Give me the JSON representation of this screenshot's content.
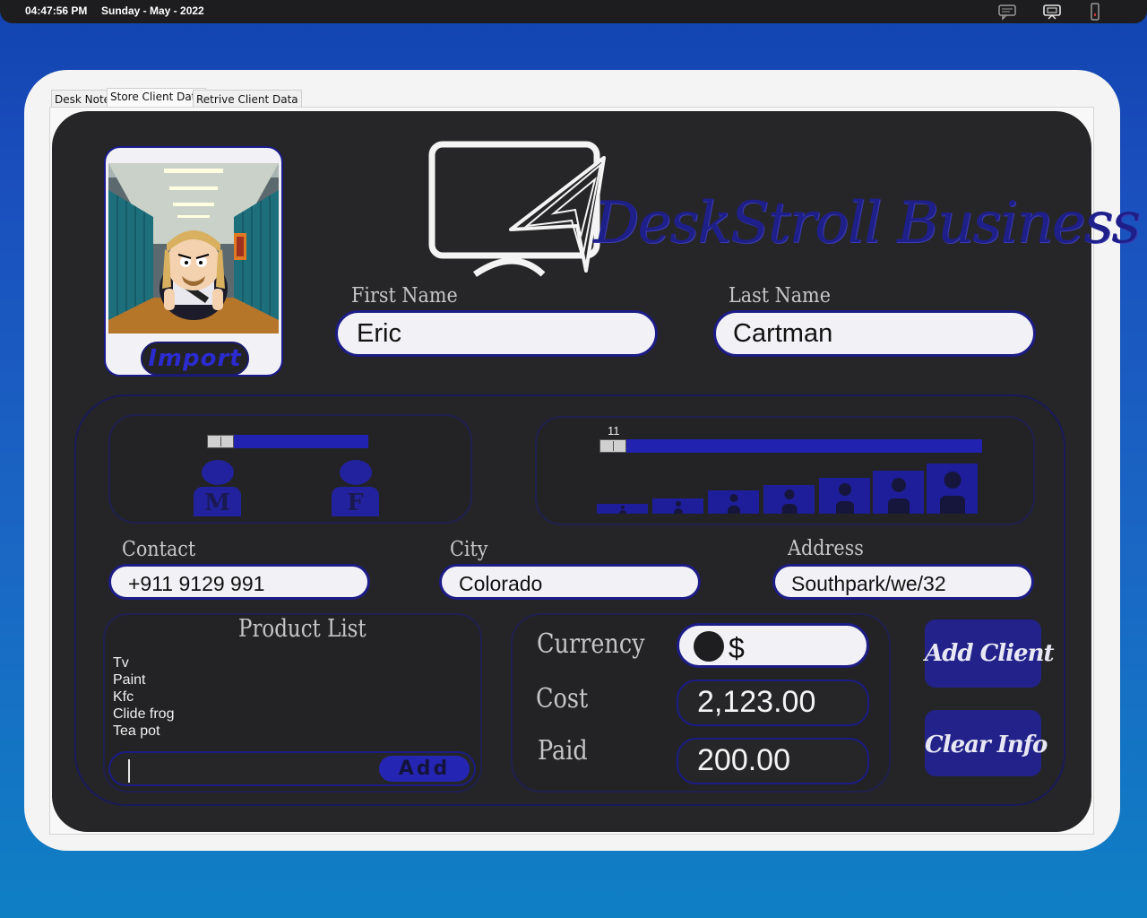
{
  "status_bar": {
    "time": "04:47:56 PM",
    "date": "Sunday - May - 2022",
    "icons": [
      "chat-bubble-icon",
      "monitor-icon",
      "phone-icon"
    ]
  },
  "tabs": [
    {
      "label": "Desk Note",
      "active": false
    },
    {
      "label": "Store Client Data",
      "active": true
    },
    {
      "label": "Retrive Client Data",
      "active": false
    }
  ],
  "brand": {
    "name": "DeskStroll Business"
  },
  "photo": {
    "import_label": "Import"
  },
  "form": {
    "first_name": {
      "label": "First Name",
      "value": "Eric"
    },
    "last_name": {
      "label": "Last Name",
      "value": "Cartman"
    },
    "contact": {
      "label": "Contact",
      "value": "+911 9129 991"
    },
    "city": {
      "label": "City",
      "value": "Colorado"
    },
    "address": {
      "label": "Address",
      "value": "Southpark/we/32"
    }
  },
  "gender": {
    "slider_value": 0,
    "options": [
      "M",
      "F"
    ]
  },
  "age": {
    "value": "11",
    "fraction": 0.05
  },
  "products": {
    "title": "Product List",
    "items": [
      "Tv",
      "Paint",
      "Kfc",
      "Clide frog",
      "Tea pot"
    ],
    "input_value": "",
    "add_label": "Add"
  },
  "payment": {
    "currency_label": "Currency",
    "currency_value": "$",
    "cost_label": "Cost",
    "cost_value": "2,123.00",
    "paid_label": "Paid",
    "paid_value": "200.00"
  },
  "actions": {
    "add_client": "Add Client",
    "clear_info": "Clear Info"
  },
  "colors": {
    "accent": "#2222b0",
    "panel": "#262628",
    "brand_text": "#1f1f8a"
  }
}
